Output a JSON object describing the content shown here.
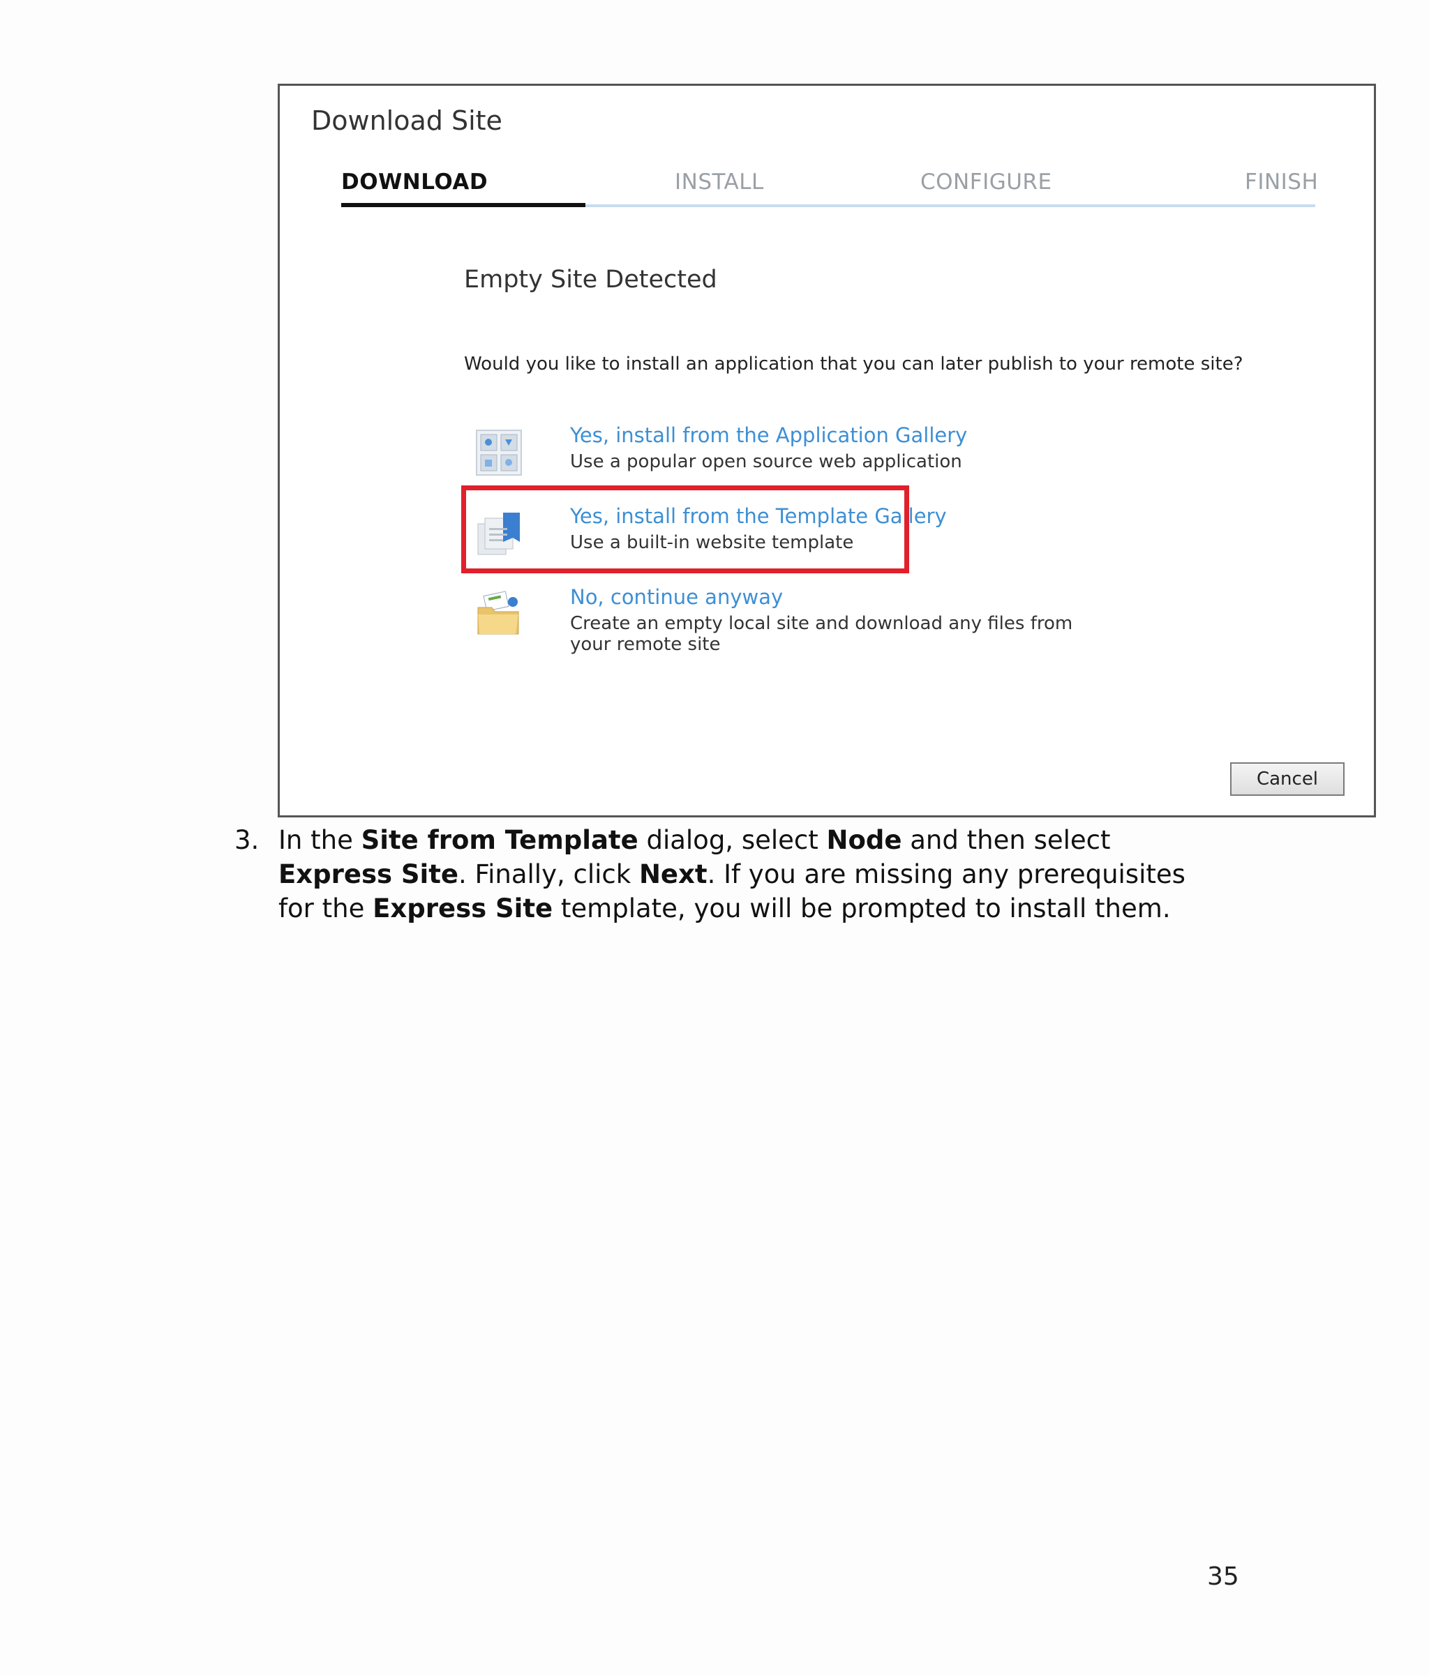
{
  "dialog": {
    "title": "Download Site",
    "steps": [
      "DOWNLOAD",
      "INSTALL",
      "CONFIGURE",
      "FINISH"
    ],
    "active_step": "DOWNLOAD",
    "heading": "Empty Site Detected",
    "question": "Would you like to install an application that you can later publish to your remote site?",
    "options": [
      {
        "title": "Yes, install from the Application Gallery",
        "description": "Use a popular open source web application",
        "icon": "application-gallery-icon"
      },
      {
        "title": "Yes, install from the Template Gallery",
        "description": "Use a built-in website template",
        "icon": "template-gallery-icon",
        "highlighted": true
      },
      {
        "title": "No, continue anyway",
        "description": "Create an empty local site and download any files from your remote site",
        "icon": "folder-icon"
      }
    ],
    "cancel_label": "Cancel",
    "highlight_color": "#e0202b",
    "link_color": "#3d8fd4"
  },
  "instruction": {
    "number": "3.",
    "parts": [
      {
        "text": "In the ",
        "bold": false
      },
      {
        "text": "Site from Template",
        "bold": true
      },
      {
        "text": " dialog, select ",
        "bold": false
      },
      {
        "text": "Node",
        "bold": true
      },
      {
        "text": " and then select ",
        "bold": false
      },
      {
        "text": "Express Site",
        "bold": true
      },
      {
        "text": ". Finally, click ",
        "bold": false
      },
      {
        "text": "Next",
        "bold": true
      },
      {
        "text": ". If you are missing any prerequisites for the ",
        "bold": false
      },
      {
        "text": "Express Site",
        "bold": true
      },
      {
        "text": " template, you will be prompted to install them.",
        "bold": false
      }
    ]
  },
  "page_number": "35"
}
